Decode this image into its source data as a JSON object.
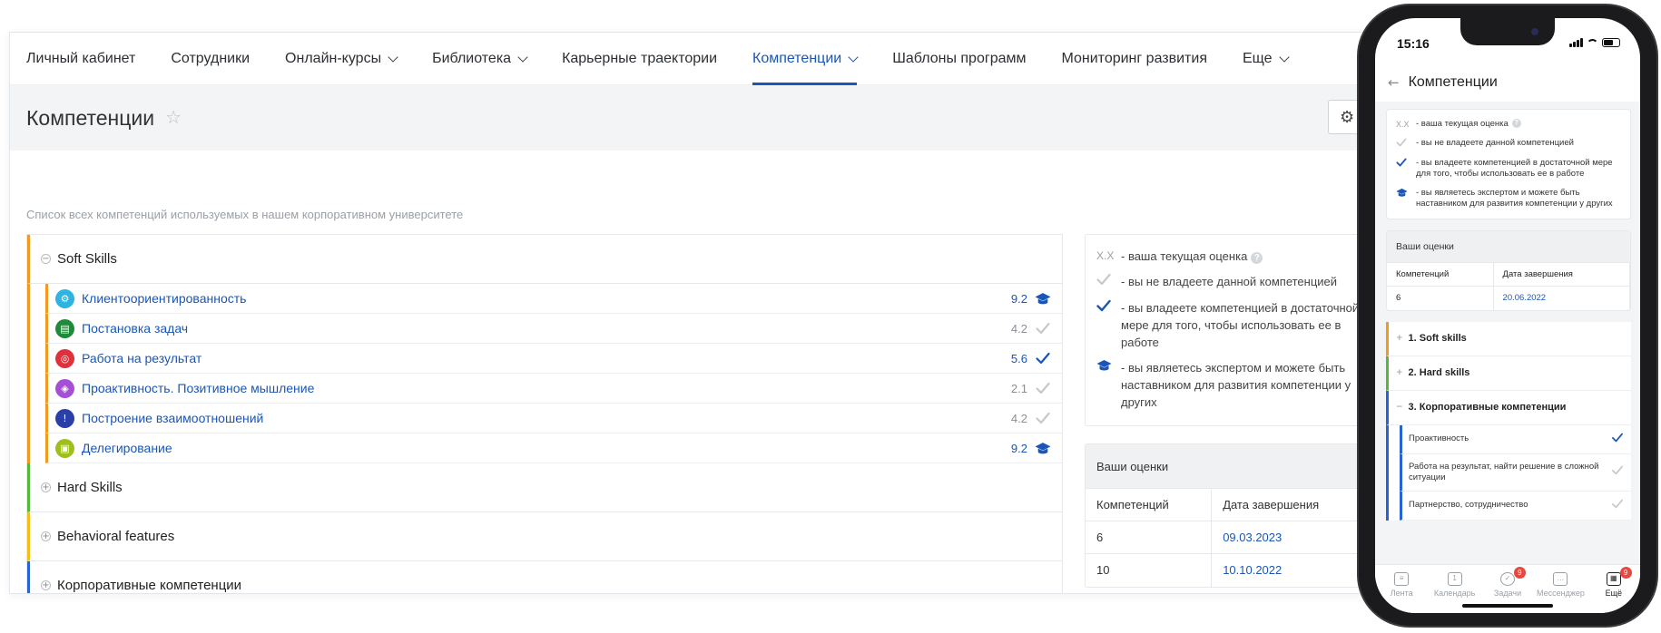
{
  "nav": {
    "items": [
      {
        "label": "Личный кабинет",
        "dropdown": false,
        "active": false
      },
      {
        "label": "Сотрудники",
        "dropdown": false,
        "active": false
      },
      {
        "label": "Онлайн-курсы",
        "dropdown": true,
        "active": false
      },
      {
        "label": "Библиотека",
        "dropdown": true,
        "active": false
      },
      {
        "label": "Карьерные траектории",
        "dropdown": false,
        "active": false
      },
      {
        "label": "Компетенции",
        "dropdown": true,
        "active": true
      },
      {
        "label": "Шаблоны программ",
        "dropdown": false,
        "active": false
      },
      {
        "label": "Мониторинг развития",
        "dropdown": false,
        "active": false
      },
      {
        "label": "Еще",
        "dropdown": true,
        "active": false
      }
    ]
  },
  "page": {
    "title": "Компетенции",
    "subtitle": "Список всех компетенций используемых в нашем корпоративном университете"
  },
  "tree": {
    "groups": [
      {
        "name": "Soft Skills",
        "expanded": true,
        "color": "#f29a1f",
        "children": [
          {
            "name": "Клиентоориентированность",
            "score": "9.2",
            "status": "expert",
            "icon": "gear-icon",
            "icon_color": "#2fb3e0"
          },
          {
            "name": "Постановка задач",
            "score": "4.2",
            "status": "none",
            "icon": "id-card-icon",
            "icon_color": "#1f8a3a"
          },
          {
            "name": "Работа на результат",
            "score": "5.6",
            "status": "sufficient",
            "icon": "target-icon",
            "icon_color": "#e0303b"
          },
          {
            "name": "Проактивность. Позитивное мышление",
            "score": "2.1",
            "status": "none",
            "icon": "shield-icon",
            "icon_color": "#a64fd6"
          },
          {
            "name": "Построение взаимоотношений",
            "score": "4.2",
            "status": "none",
            "icon": "award-icon",
            "icon_color": "#2a3fa8"
          },
          {
            "name": "Делегирование",
            "score": "9.2",
            "status": "expert",
            "icon": "badge-icon",
            "icon_color": "#9fbf1f"
          }
        ]
      },
      {
        "name": "Hard Skills",
        "expanded": false,
        "color": "#56b83a",
        "children": []
      },
      {
        "name": "Behavioral features",
        "expanded": false,
        "color": "#f3bd1b",
        "children": []
      },
      {
        "name": "Корпоративные компетенции",
        "expanded": false,
        "color": "#2a63d6",
        "children": []
      }
    ]
  },
  "legend": {
    "score_key": "X.X",
    "score_text": "- ваша текущая оценка",
    "help": "?",
    "none_text": "- вы не владеете данной компетенцией",
    "sufficient_text": "- вы владеете компетенцией в достаточной мере для того, чтобы использовать ее в работе",
    "expert_text": "- вы являетесь экспертом и можете быть наставником для развития компетенции у других"
  },
  "scores": {
    "title": "Ваши оценки",
    "col_count": "Компетенций",
    "col_date": "Дата завершения",
    "rows": [
      {
        "count": "6",
        "date": "09.03.2023"
      },
      {
        "count": "10",
        "date": "10.10.2022"
      }
    ]
  },
  "phone": {
    "time": "15:16",
    "title": "Компетенции",
    "legend": {
      "score_key": "X.X",
      "score_text": "- ваша текущая оценка",
      "none_text": "- вы не владеете данной компетенцией",
      "sufficient_text": "- вы владеете компетенцией в достаточной мере для того, чтобы использовать ее в работе",
      "expert_text": "- вы являетесь экспертом и можете быть наставником для развития компетенции у других"
    },
    "scores": {
      "title": "Ваши оценки",
      "col_count": "Компетенций",
      "col_date": "Дата завершения",
      "rows": [
        {
          "count": "6",
          "date": "20.06.2022"
        }
      ]
    },
    "groups": [
      {
        "name": "1. Soft skills",
        "color": "#f29a1f",
        "toggle": "+"
      },
      {
        "name": "2. Hard skills",
        "color": "#56b83a",
        "toggle": "+"
      },
      {
        "name": "3. Корпоративные компетенции",
        "color": "#2a63d6",
        "toggle": "−"
      }
    ],
    "children": [
      {
        "name": "Проактивность",
        "status": "sufficient"
      },
      {
        "name": "Работа на результат, найти решение в сложной ситуации",
        "status": "none"
      },
      {
        "name": "Партнерство, сотрудничество",
        "status": "none"
      }
    ],
    "tabs": [
      {
        "label": "Лента",
        "icon": "feed-icon",
        "badge": "",
        "active": false
      },
      {
        "label": "Календарь",
        "icon": "calendar-icon",
        "badge": "",
        "active": false
      },
      {
        "label": "Задачи",
        "icon": "tasks-icon",
        "badge": "9",
        "active": false
      },
      {
        "label": "Мессенджер",
        "icon": "chat-icon",
        "badge": "",
        "active": false
      },
      {
        "label": "Ещё",
        "icon": "grid-icon",
        "badge": "9",
        "active": true
      }
    ]
  }
}
